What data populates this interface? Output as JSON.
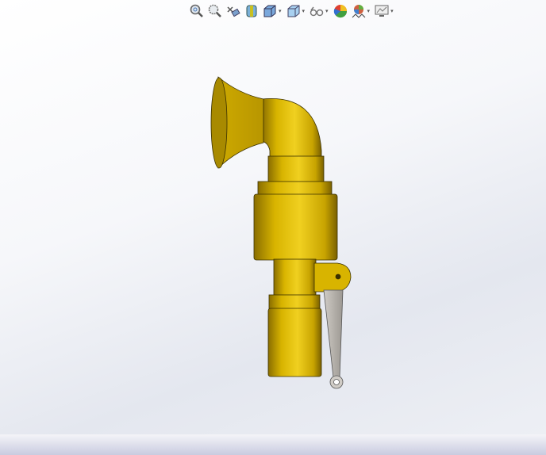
{
  "toolbar": {
    "items": [
      {
        "icon": "zoom-to-fit-icon",
        "dropdown": false
      },
      {
        "icon": "zoom-to-area-icon",
        "dropdown": false
      },
      {
        "icon": "previous-view-icon",
        "dropdown": false
      },
      {
        "icon": "section-view-icon",
        "dropdown": false
      },
      {
        "icon": "view-orientation-icon",
        "dropdown": true
      },
      {
        "icon": "display-style-icon",
        "dropdown": true
      },
      {
        "icon": "hide-show-items-icon",
        "dropdown": true
      },
      {
        "icon": "edit-appearance-icon",
        "dropdown": false
      },
      {
        "icon": "apply-scene-icon",
        "dropdown": true
      },
      {
        "icon": "view-settings-icon",
        "dropdown": true
      }
    ],
    "caret": "▾"
  },
  "colors": {
    "part_yellow": "#d8b400",
    "part_dark": "#7a6200",
    "lever_grey": "#b8b4ae"
  }
}
